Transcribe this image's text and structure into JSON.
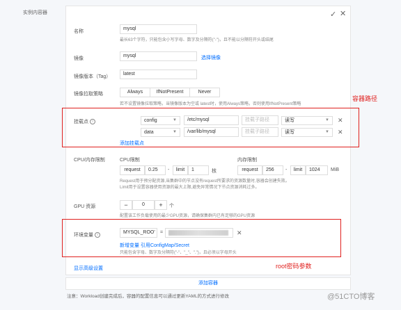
{
  "section_label": "实例内容器",
  "header": {
    "confirm_icon": "✓",
    "close_icon": "✕"
  },
  "name": {
    "label": "名称",
    "value": "mysql",
    "help": "最长63个字符，只能包含小写字母、数字及分隔符(\"-\")，且不能以分隔符开头或结尾"
  },
  "image": {
    "label": "镜像",
    "value": "mysql",
    "select_link": "选择镜像"
  },
  "image_version": {
    "label": "镜像版本（Tag）",
    "value": "latest"
  },
  "pull_policy": {
    "label": "镜像拉取策略",
    "options": [
      "Always",
      "IfNotPresent",
      "Never"
    ],
    "help": "若不设置镜像拉取策略，当镜像版本为空或 latest时，使用Always策略，否则使用IfNotPresent策略"
  },
  "mounts": {
    "label": "挂载点",
    "rows": [
      {
        "volume": "config",
        "path": "/etc/mysql",
        "subpath_placeholder": "挂载子路径",
        "mode": "读写"
      },
      {
        "volume": "data",
        "path": "/var/lib/mysql",
        "subpath_placeholder": "挂载子路径",
        "mode": "读写"
      }
    ],
    "add_link": "添加挂载点"
  },
  "annotations": {
    "container_path": "容器路径",
    "root_password": "root密码参数"
  },
  "cpu_memory": {
    "label": "CPU/内存限制",
    "cpu_title": "CPU限制",
    "mem_title": "内存限制",
    "request_label": "request",
    "limit_label": "limit",
    "cpu_request": "0.25",
    "cpu_limit": "1",
    "cpu_unit": "核",
    "mem_request": "256",
    "mem_limit": "1024",
    "mem_unit": "MiB",
    "dash": "-",
    "help1": "Request用于预分配资源,当集群中的节点没有request所要求的资源数量时,容器会创建失败。",
    "help2": "Limit用于设置容器使用资源的最大上限,避免异常情况下节点资源消耗过多。"
  },
  "gpu": {
    "label": "GPU 资源",
    "minus": "−",
    "value": "0",
    "plus": "+",
    "unit": "个",
    "help": "配置该工作负载使用的最少GPU资源，请确保集群内已有足够的GPU资源"
  },
  "env": {
    "label": "环境变量",
    "key": "MYSQL_ROO'",
    "eq": "=",
    "actions_new_var": "新增变量",
    "actions_ref": "引用ConfigMap/Secret",
    "help": "只能包含字母、数字及分隔符(\"-\"、\"_\"、\".\")，且必须以字母开头"
  },
  "advanced_link": "显示高级设置",
  "add_container": "添加容器",
  "note": "注意：Workload创建完成后，容器的配置信息可以通过更新YAML的方式进行修改",
  "watermark": "@51CTO博客"
}
